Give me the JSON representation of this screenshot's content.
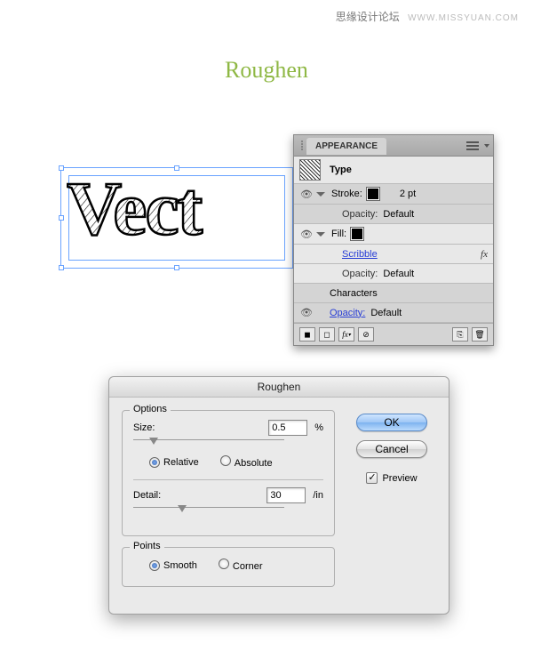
{
  "watermark": {
    "cn": "思缘设计论坛",
    "url": "WWW.MISSYUAN.COM"
  },
  "title": "Roughen",
  "canvas_text": "Vect",
  "appearance": {
    "tab": "APPEARANCE",
    "type": "Type",
    "stroke_label": "Stroke:",
    "stroke_value": "2 pt",
    "opacity_label": "Opacity:",
    "opacity_default": "Default",
    "fill_label": "Fill:",
    "scribble": "Scribble",
    "characters": "Characters",
    "fx_label": "fx"
  },
  "dialog": {
    "title": "Roughen",
    "options_legend": "Options",
    "size_label": "Size:",
    "size_value": "0.5",
    "size_unit": "%",
    "relative": "Relative",
    "absolute": "Absolute",
    "detail_label": "Detail:",
    "detail_value": "30",
    "detail_unit": "/in",
    "points_legend": "Points",
    "smooth": "Smooth",
    "corner": "Corner",
    "ok": "OK",
    "cancel": "Cancel",
    "preview": "Preview"
  }
}
